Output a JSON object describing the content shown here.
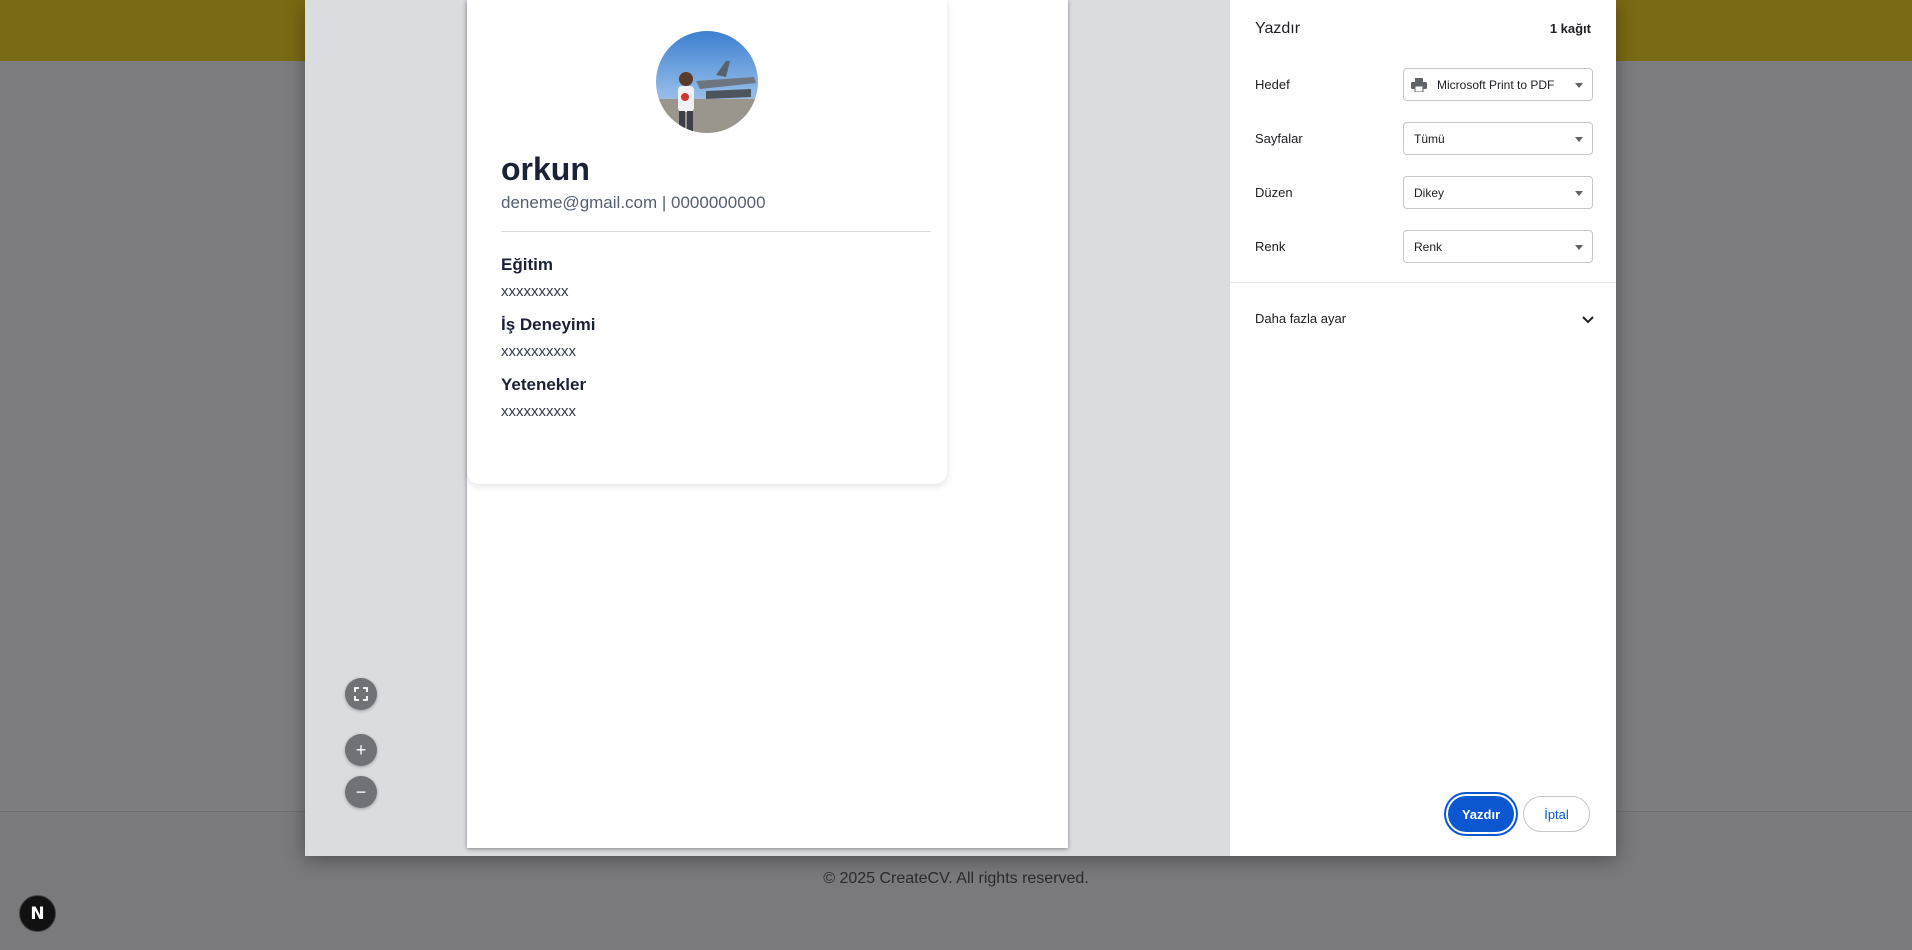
{
  "page": {
    "footer": "© 2025 CreateCV. All rights reserved.",
    "badge": "N"
  },
  "cv": {
    "name": "orkun",
    "contact": "deneme@gmail.com | 0000000000",
    "sections": [
      {
        "title": "Eğitim",
        "text": "xxxxxxxxx"
      },
      {
        "title": "İş Deneyimi",
        "text": "xxxxxxxxxx"
      },
      {
        "title": "Yetenekler",
        "text": "xxxxxxxxxx"
      }
    ]
  },
  "zoom": {
    "fit": "⛶",
    "in": "+",
    "out": "−"
  },
  "settings": {
    "title": "Yazdır",
    "sheets": "1 kağıt",
    "rows": [
      {
        "label": "Hedef",
        "value": "Microsoft Print to PDF"
      },
      {
        "label": "Sayfalar",
        "value": "Tümü"
      },
      {
        "label": "Düzen",
        "value": "Dikey"
      },
      {
        "label": "Renk",
        "value": "Renk"
      }
    ],
    "more": "Daha fazla ayar",
    "print_btn": "Yazdır",
    "cancel_btn": "İptal"
  },
  "colors": {
    "accent": "#0b57d0",
    "header_bg": "#7b6a14"
  }
}
